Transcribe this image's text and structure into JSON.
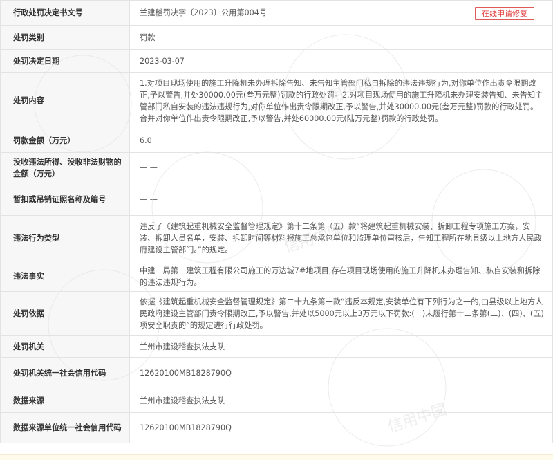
{
  "repair_button": "在线申请修复",
  "watermark_text": "信用中国",
  "rows": [
    {
      "label": "行政处罚决定书文号",
      "value": "兰建稽罚决字〔2023〕公用第004号"
    },
    {
      "label": "处罚类别",
      "value": "罚款"
    },
    {
      "label": "处罚决定日期",
      "value": "2023-03-07"
    },
    {
      "label": "处罚内容",
      "value": "1.对项目现场使用的施工升降机未办理拆除告知、未告知主管部门私自拆除的违法违规行为,对你单位作出责令限期改正,予以警告,并处30000.00元(叁万元整)罚款的行政处罚。2.对项目现场使用的施工升降机未办理安装告知、未告知主管部门私自安装的违法违规行为,对你单位作出责令限期改正,予以警告,并处30000.00元(叁万元整)罚款的行政处罚。合并对你单位作出责令限期改正,予以警告,并处60000.00元(陆万元整)罚款的行政处罚。"
    },
    {
      "label": "罚款金额（万元）",
      "value": "6.0"
    },
    {
      "label": "没收违法所得、没收非法财物的金额（万元）",
      "value": "— —"
    },
    {
      "label": "暂扣或吊销证照名称及编号",
      "value": "— —"
    },
    {
      "label": "违法行为类型",
      "value": "违反了《建筑起重机械安全监督管理规定》第十二条第（五）款“将建筑起重机械安装、拆卸工程专项施工方案，安装、拆卸人员名单，安装、拆卸时间等材料报施工总承包单位和监理单位审核后，告知工程所在地县级以上地方人民政府建设主管部门。”的规定。"
    },
    {
      "label": "违法事实",
      "value": "中建二局第一建筑工程有限公司施工的万达城7#地项目,存在项目现场使用的施工升降机未办理告知、私自安装和拆除的违法违规行为。"
    },
    {
      "label": "处罚依据",
      "value": "依据《建筑起重机械安全监督管理规定》第二十九条第一款“违反本规定,安装单位有下列行为之一的,由县级以上地方人民政府建设主管部门责令限期改正,予以警告,并处以5000元以上3万元以下罚款:(一)未履行第十二条第(二)、(四)、(五)项安全职责的”的规定进行行政处罚。"
    },
    {
      "label": "处罚机关",
      "value": "兰州市建设稽查执法支队"
    },
    {
      "label": "处罚机关统一社会信用代码",
      "value": "12620100MB1828790Q"
    },
    {
      "label": "数据来源",
      "value": "兰州市建设稽查执法支队"
    },
    {
      "label": "数据来源单位统一社会信用代码",
      "value": "12620100MB1828790Q"
    }
  ]
}
